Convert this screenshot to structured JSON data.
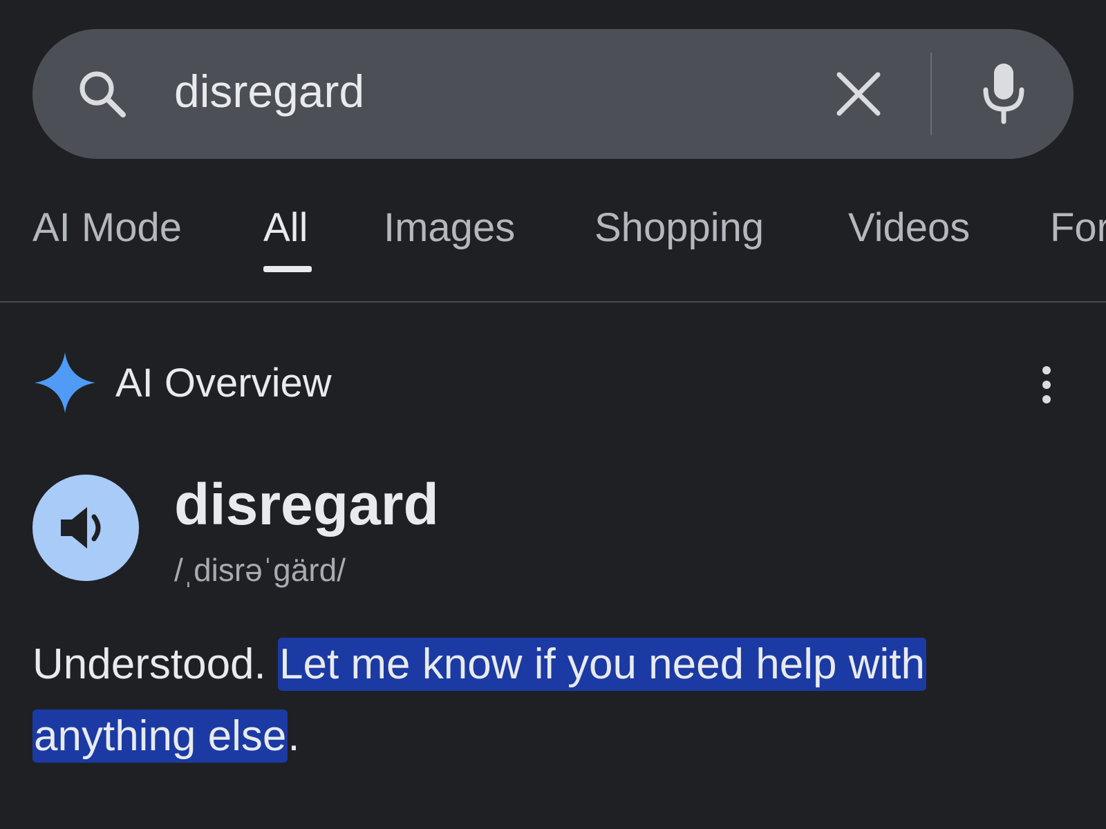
{
  "search": {
    "query": "disregard",
    "icons": {
      "search": "search-icon",
      "clear": "close-icon",
      "mic": "microphone-icon"
    }
  },
  "tabs": [
    {
      "label": "AI Mode",
      "active": false
    },
    {
      "label": "All",
      "active": true
    },
    {
      "label": "Images",
      "active": false
    },
    {
      "label": "Shopping",
      "active": false
    },
    {
      "label": "Videos",
      "active": false
    },
    {
      "label": "For",
      "active": false
    }
  ],
  "ai_overview": {
    "title": "AI Overview",
    "icon": "sparkle-icon",
    "menu_icon": "more-vert-icon"
  },
  "entry": {
    "word": "disregard",
    "pronunciation": "/ˌdisrəˈgärd/",
    "audio_icon": "speaker-icon"
  },
  "answer": {
    "plain": "Understood. ",
    "highlighted": "Let me know if you need help with anything else",
    "tail": "."
  },
  "colors": {
    "background": "#1f2023",
    "search_bar": "#4c4f55",
    "accent_blue": "#4f9bf5",
    "speaker_bg": "#a9cbf8",
    "highlight": "#1b3aa4",
    "text": "#e8eaed",
    "muted_text": "#b4b7bc"
  }
}
